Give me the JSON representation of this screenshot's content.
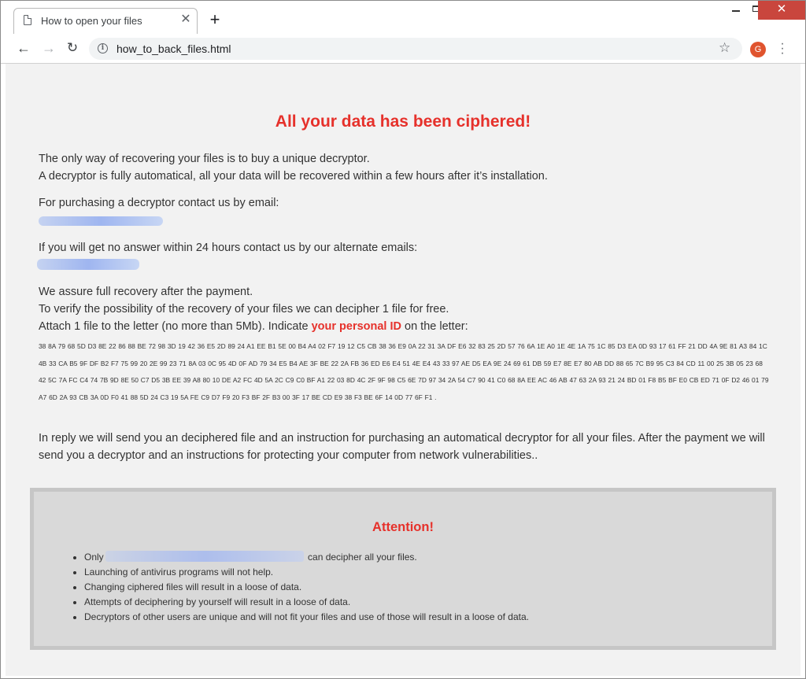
{
  "browser": {
    "tab_title": "How to open your files",
    "tab_close": "✕",
    "new_tab": "+",
    "url": "how_to_back_files.html",
    "avatar_letter": "G",
    "window_controls": {
      "minimize": "–",
      "maximize": "□",
      "close": "✕"
    }
  },
  "page": {
    "headline": "All your data has been ciphered!",
    "intro_line1": "The only way of recovering your files is to buy a unique decryptor.",
    "intro_line2": "A decryptor is fully automatical, all your data will be recovered within a few hours after it’s installation.",
    "purchase_contact": "For purchasing a decryptor contact us by email:",
    "alternate_contact": "If you will get no answer within 24 hours contact us by our alternate emails:",
    "assure_line1": "We assure full recovery after the payment.",
    "assure_line2": "To verify the possibility of the recovery of your files we can decipher 1 file for free.",
    "assure_line3_prefix": "Attach 1 file to the letter (no more than 5Mb). Indicate ",
    "assure_line3_highlight": "your personal ID",
    "assure_line3_suffix": " on the letter:",
    "personal_id": "38 8A 79 68 5D D3 8E 22 86 88 BE 72 98 3D 19 42 36 E5 2D 89 24 A1 EE B1 5E 00 B4 A4 02 F7 19 12 C5 CB 38 36 E9 0A 22 31 3A DF E6 32 83 25 2D 57 76 6A 1E A0 1E 4E 1A 75 1C 85 D3 EA 0D 93 17 61 FF 21 DD 4A 9E 81 A3 84 1C 4B 33 CA B5 9F DF B2 F7 75 99 20 2E 99 23 71 8A 03 0C 95 4D 0F AD 79 34 E5 B4 AE 3F BE 22 2A FB 36 ED E6 E4 51 4E E4 43 33 97 AE D5 EA 9E 24 69 61 DB 59 E7 8E E7 80 AB DD 88 65 7C B9 95 C3 84 CD 11 00 25 3B 05 23 68 42 5C 7A FC C4 74 7B 9D 8E 50 C7 D5 3B EE 39 A8 80 10 DE A2 FC 4D 5A 2C C9 C0 BF A1 22 03 8D 4C 2F 9F 98 C5 6E 7D 97 34 2A 54 C7 90 41 C0 68 8A EE AC 46 AB 47 63 2A 93 21 24 BD 01 F8 B5 BF E0 CB ED 71 0F D2 46 01 79 A7 6D 2A 93 CB 3A 0D F0 41 88 5D 24 C3 19 5A FE C9 D7 F9 20 F3 BF 2F B3 00 3F 17 BE CD E9 38 F3 BE 6F 14 0D 77 6F F1 .",
    "reply": "In reply we will send you an deciphered file and an instruction for purchasing an automatical decryptor for all your files. After the payment we will send you a decryptor and an instructions for protecting your computer from network vulnerabilities..",
    "attention": {
      "title": "Attention!",
      "only_prefix": "Only",
      "only_suffix": " can decipher all your files.",
      "items": [
        "Launching of antivirus programs will not help.",
        "Changing ciphered files will result in a loose of data.",
        "Attempts of deciphering by yourself will result in a loose of data.",
        "Decryptors of other users are unique and will not fit your files and use of those will result in a loose of data."
      ]
    }
  }
}
